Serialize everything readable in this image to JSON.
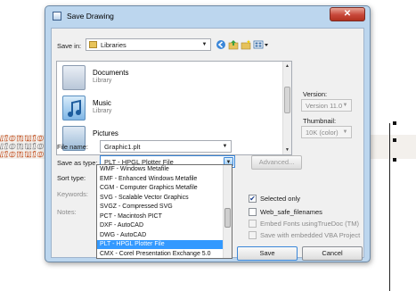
{
  "background": {
    "stripe_text": "uionuionuionuionuionuion"
  },
  "dialog": {
    "title": "Save Drawing",
    "close_glyph": "✕",
    "save_in": {
      "label": "Save in:",
      "value": "Libraries"
    },
    "toolbar_icons": [
      "back-icon",
      "up-folder-icon",
      "new-folder-icon",
      "views-menu-icon"
    ],
    "file_list": {
      "items": [
        {
          "name": "Documents",
          "type": "Library",
          "icon": "documents-library-icon"
        },
        {
          "name": "Music",
          "type": "Library",
          "icon": "music-library-icon"
        },
        {
          "name": "Pictures",
          "type": "",
          "icon": "pictures-library-icon"
        }
      ]
    },
    "version": {
      "label": "Version:",
      "value": "Version 11.0"
    },
    "thumbnail": {
      "label": "Thumbnail:",
      "value": "10K (color)"
    },
    "file_name": {
      "label": "File name:",
      "value": "Graphic1.plt"
    },
    "save_as_type": {
      "label": "Save as type:",
      "value": "PLT - HPGL Plotter File",
      "options": [
        "WMF - Windows Metafile",
        "EMF - Enhanced Windows Metafile",
        "CGM - Computer Graphics Metafile",
        "SVG - Scalable Vector Graphics",
        "SVGZ - Compressed SVG",
        "PCT - Macintosh PICT",
        "DXF - AutoCAD",
        "DWG - AutoCAD",
        "PLT - HPGL Plotter File",
        "CMX - Corel Presentation Exchange 5.0"
      ],
      "selected_index": 8
    },
    "advanced_button": "Advanced...",
    "sort_type_label": "Sort type:",
    "keywords_label": "Keywords:",
    "notes_label": "Notes:",
    "checkboxes": [
      {
        "label": "Selected only",
        "checked": true,
        "enabled": true
      },
      {
        "label": "Web_safe_filenames",
        "checked": false,
        "enabled": true
      },
      {
        "label": "Embed Fonts usingTrueDoc (TM)",
        "checked": false,
        "enabled": false
      },
      {
        "label": "Save with embedded VBA Project",
        "checked": false,
        "enabled": false
      }
    ],
    "save_button": "Save",
    "cancel_button": "Cancel"
  }
}
